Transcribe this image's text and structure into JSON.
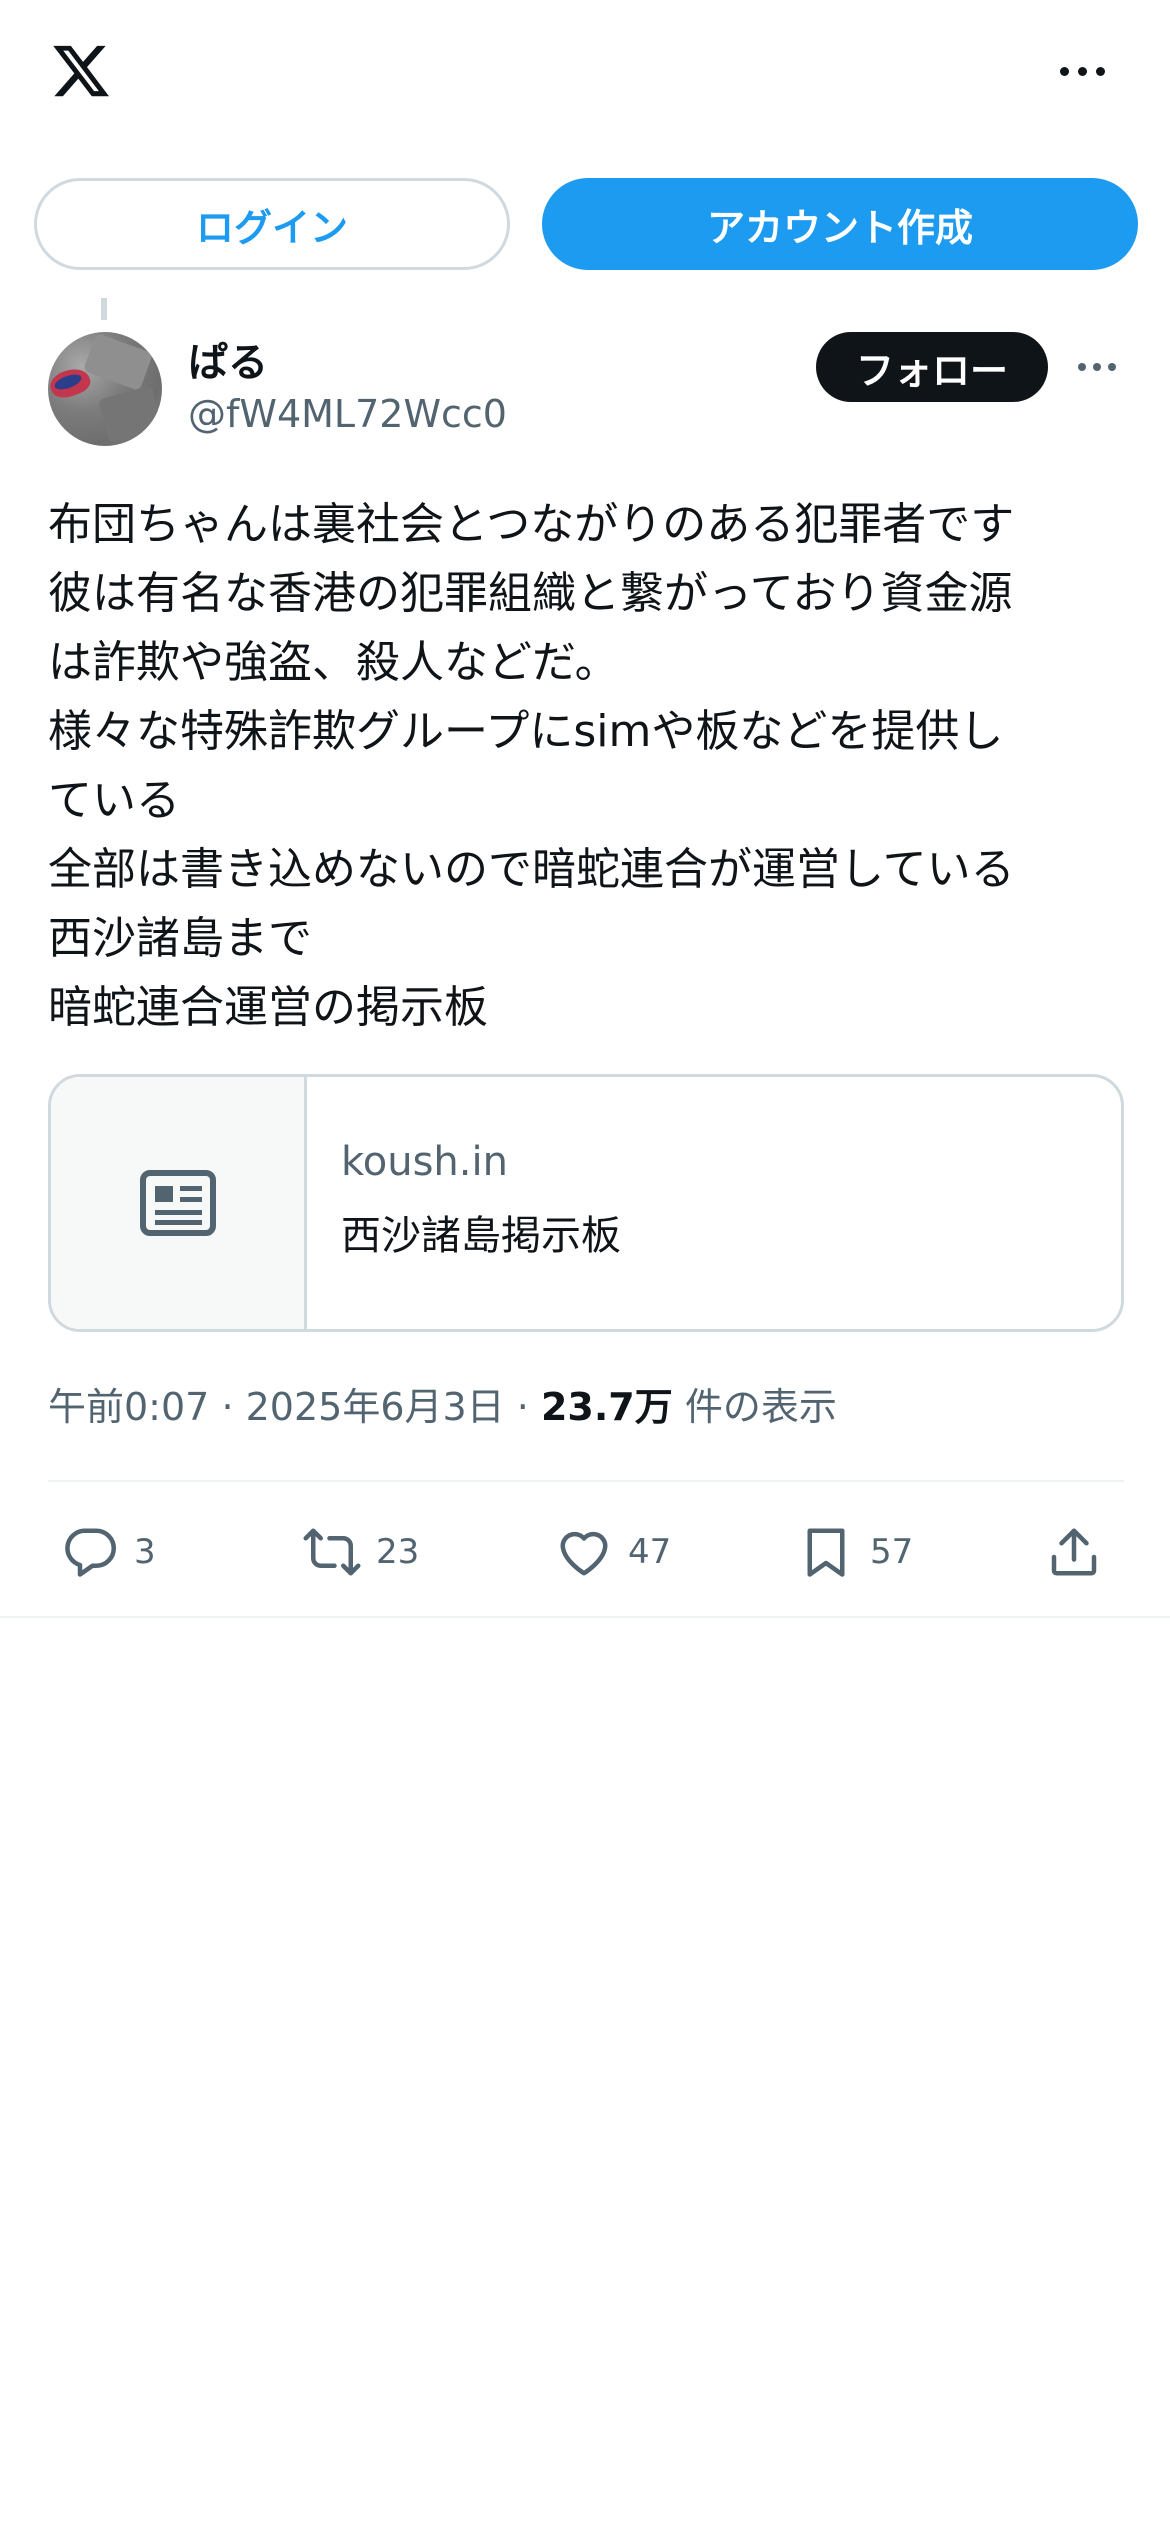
{
  "header": {
    "logo_icon": "x-logo-icon",
    "more_icon": "more-horizontal-icon"
  },
  "auth": {
    "login_label": "ログイン",
    "signup_label": "アカウント作成"
  },
  "author": {
    "display_name": "ぱる",
    "handle": "@fW4ML72Wcc0",
    "follow_label": "フォロー"
  },
  "post": {
    "lines": [
      "布団ちゃんは裏社会とつながりのある犯罪者です",
      "彼は有名な香港の犯罪組織と繋がっており資金源",
      "は詐欺や強盗、殺人などだ。",
      "様々な特殊詐欺グループにsimや板などを提供し",
      "ている",
      "全部は書き込めないので暗蛇連合が運営している",
      "西沙諸島まで",
      "暗蛇連合運営の掲示板"
    ]
  },
  "link_card": {
    "domain": "koush.in",
    "title": "西沙諸島掲示板",
    "icon": "article-icon"
  },
  "meta": {
    "time": "午前0:07",
    "date": "2025年6月3日",
    "views": "23.7万",
    "views_suffix": "件の表示",
    "separator": "·"
  },
  "actions": {
    "replies": "3",
    "reposts": "23",
    "likes": "47",
    "bookmarks": "57"
  },
  "colors": {
    "accent": "#1d9bf0",
    "text": "#0f1419",
    "secondary": "#536471",
    "border": "#cfd9de"
  }
}
